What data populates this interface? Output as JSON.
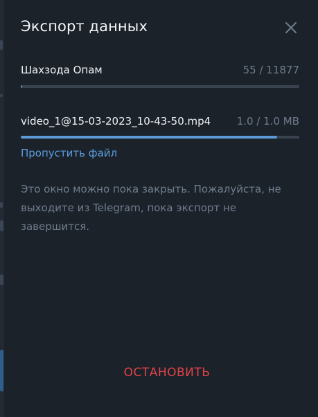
{
  "dialog": {
    "title": "Экспорт данных",
    "close_icon": "close-icon"
  },
  "chat_progress": {
    "label": "Шахзода Опам",
    "counter": "55 / 11877",
    "fraction": 0.0046
  },
  "file_progress": {
    "label": "video_1@15-03-2023_10-43-50.mp4",
    "counter": "1.0 / 1.0 MB",
    "fraction": 0.92
  },
  "skip_label": "Пропустить файл",
  "info": "Это окно можно пока закрыть. Пожалуйста, не выходите из Telegram, пока экспорт не завершится.",
  "stop_label": "ОСТАНОВИТЬ",
  "colors": {
    "accent": "#5b9ad6",
    "link": "#5a9ee0",
    "danger": "#e0434a",
    "background": "#1c222a"
  }
}
